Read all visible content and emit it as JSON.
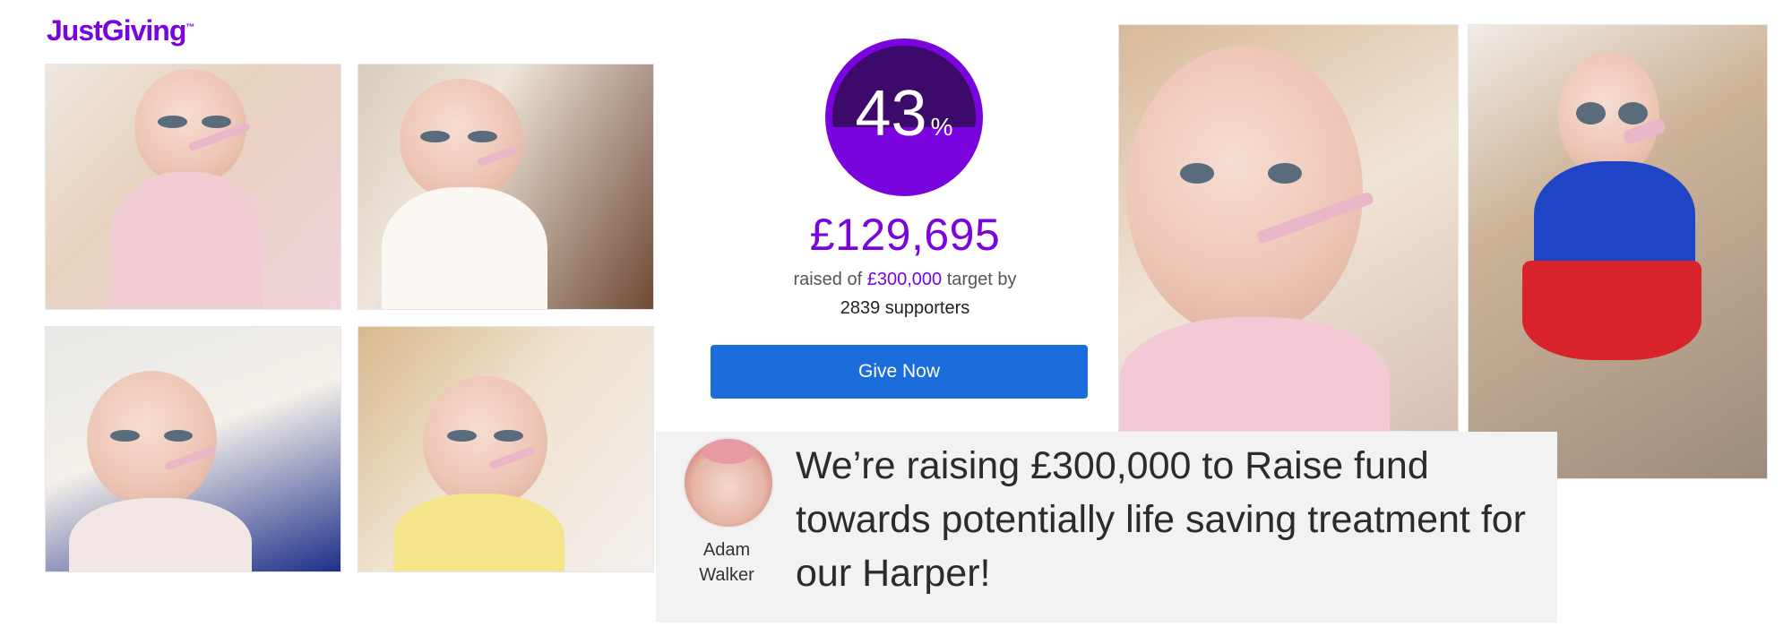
{
  "brand": {
    "logo_text": "JustGiving",
    "logo_tm": "™",
    "color": "#7a04dd"
  },
  "fundraiser": {
    "percent": 43,
    "percent_text": "43",
    "percent_sign": "%",
    "raised_amount": "£129,695",
    "raised_prefix": "raised of",
    "target_amount": "£300,000",
    "raised_suffix": "target by",
    "supporters_text": "2839 supporters",
    "give_button_label": "Give Now",
    "button_color": "#1b6ddb"
  },
  "story": {
    "creator_first": "Adam",
    "creator_last": "Walker",
    "title": "We’re raising £300,000 to Raise fund towards potentially life saving treatment for our Harper!"
  },
  "photos": [
    {
      "icon": "photo-baby-in-cot"
    },
    {
      "icon": "photo-baby-on-sofa"
    },
    {
      "icon": "photo-baby-in-hospital"
    },
    {
      "icon": "photo-baby-in-bed"
    },
    {
      "icon": "photo-baby-closeup"
    },
    {
      "icon": "photo-baby-supergirl-costume"
    }
  ]
}
